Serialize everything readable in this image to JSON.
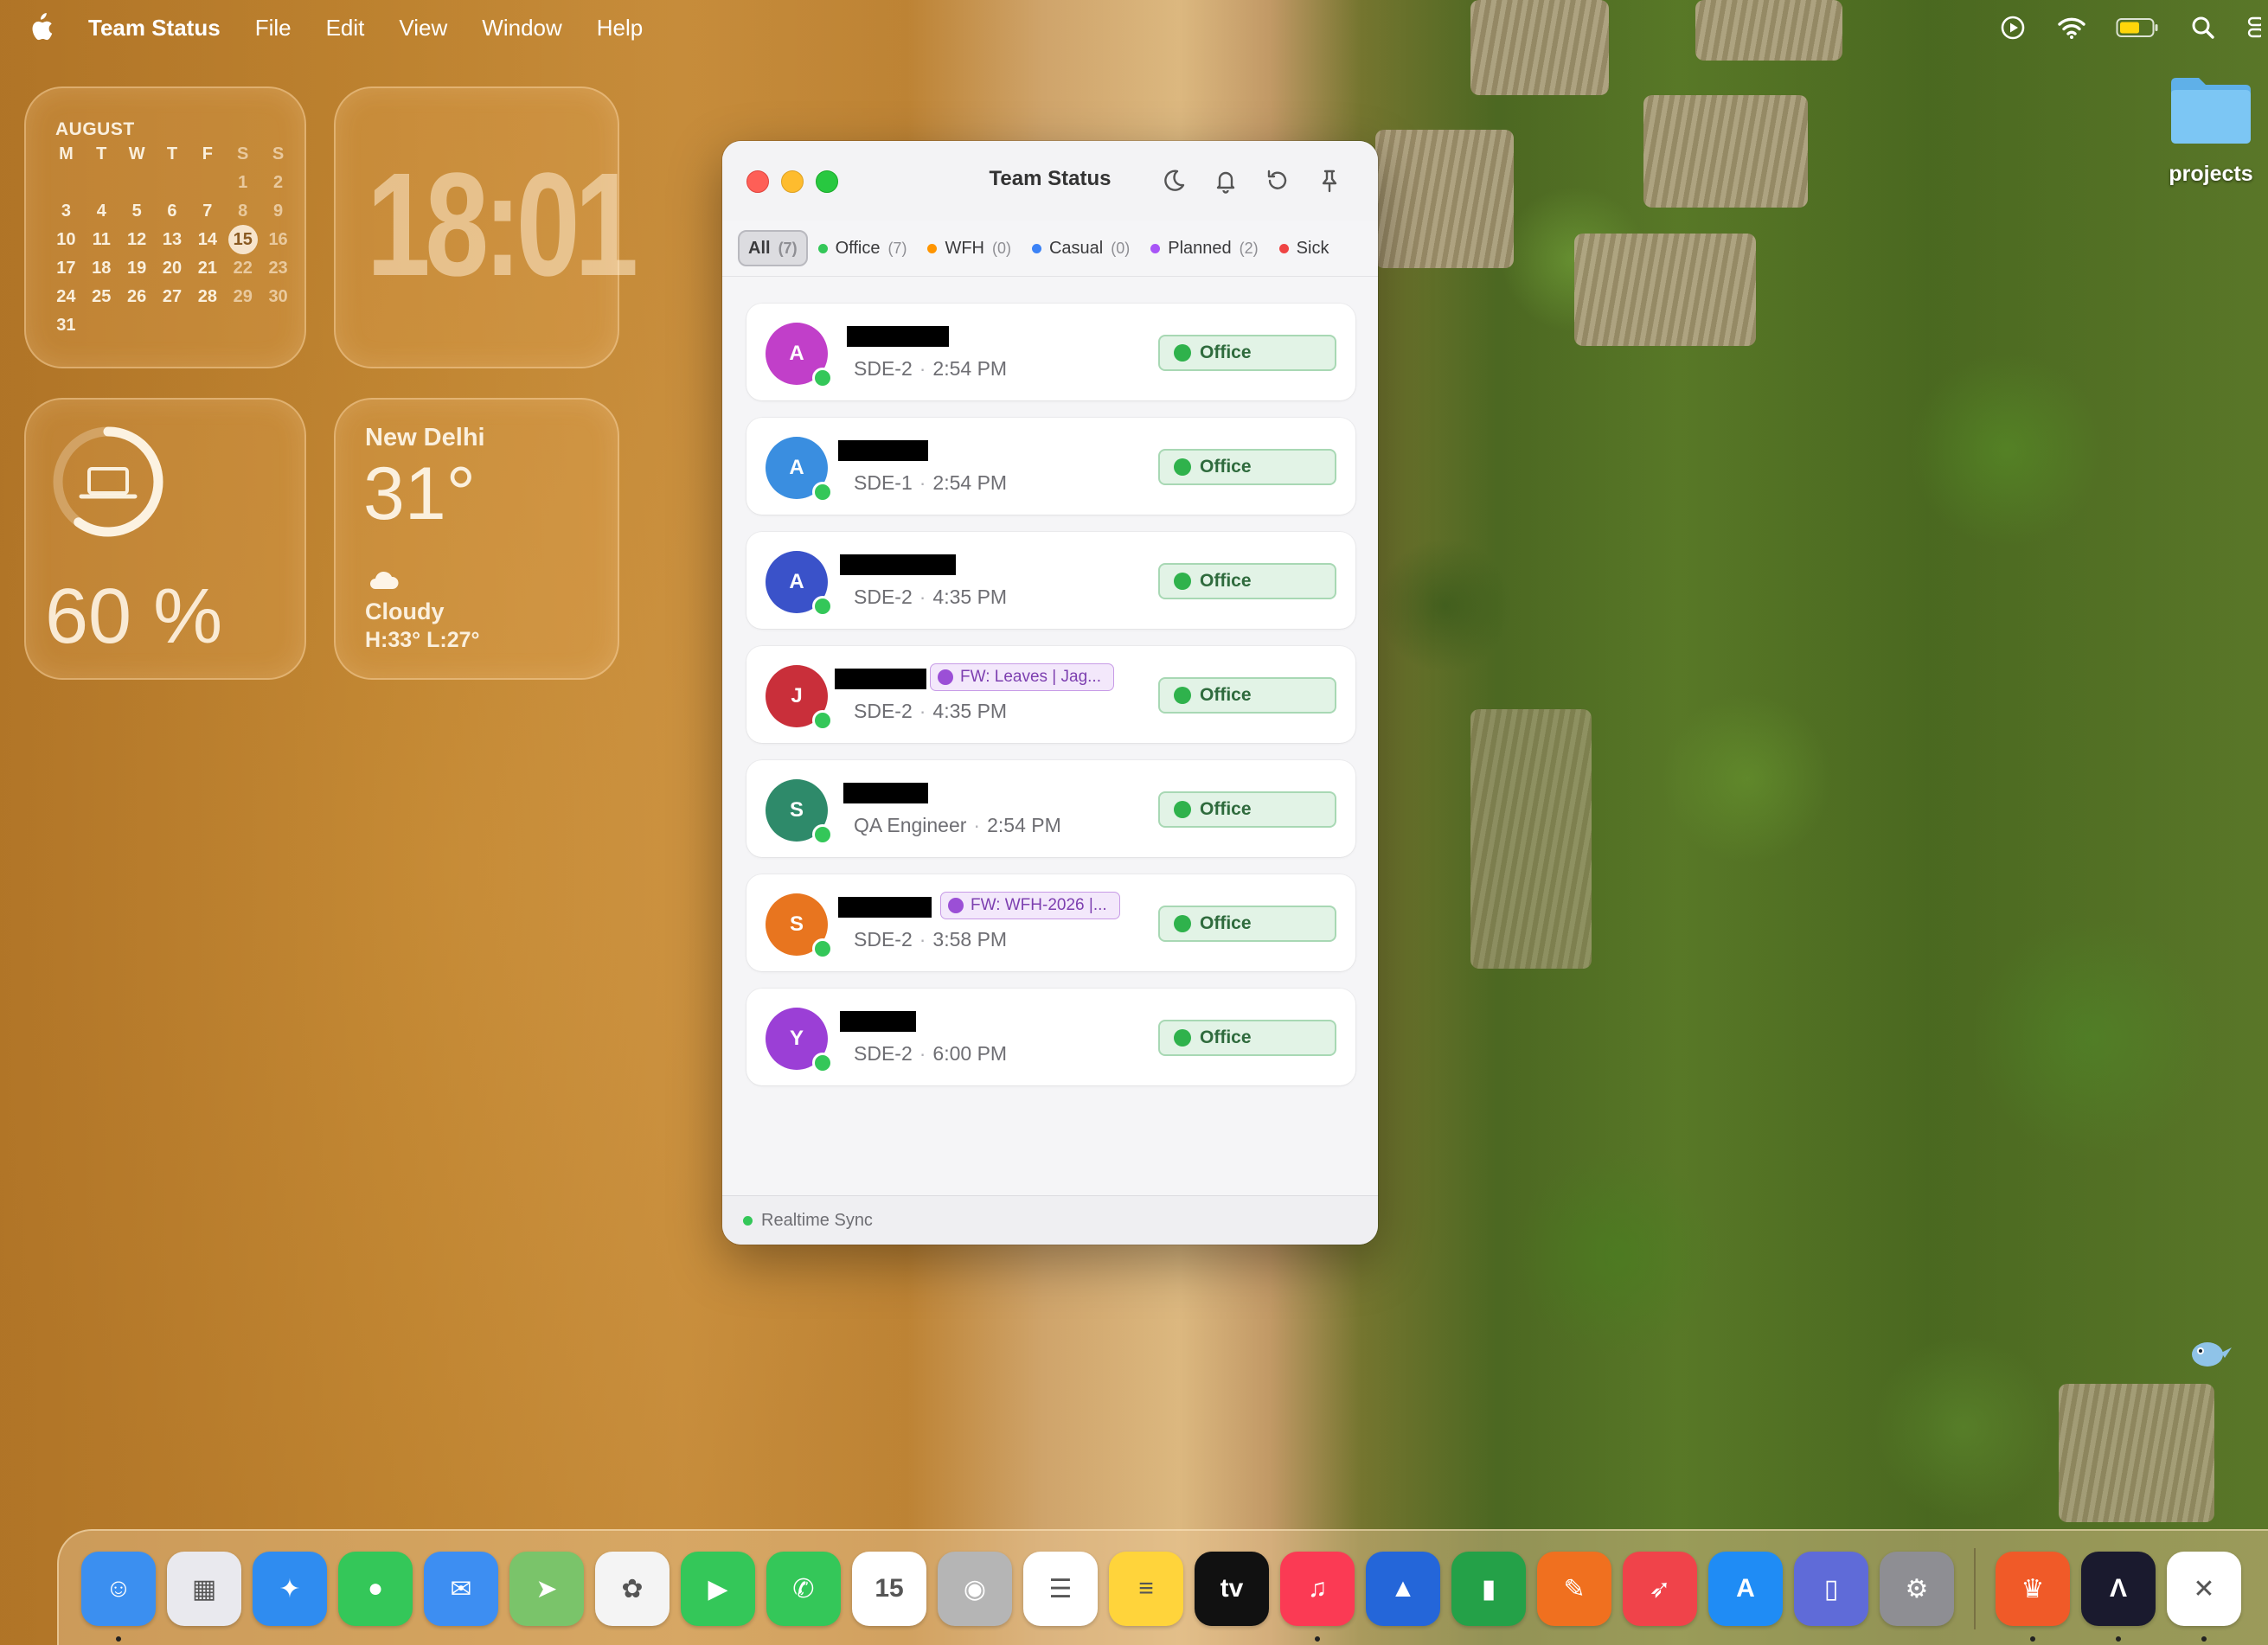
{
  "menubar": {
    "app_name": "Team Status",
    "menus": [
      "File",
      "Edit",
      "View",
      "Window",
      "Help"
    ],
    "status_icons": [
      "play-circle-icon",
      "wifi-icon",
      "battery-icon",
      "search-icon",
      "control-center-icon"
    ]
  },
  "widgets": {
    "calendar": {
      "month": "AUGUST",
      "weekdays": [
        "M",
        "T",
        "W",
        "T",
        "F",
        "S",
        "S"
      ],
      "today": "15",
      "weeks": [
        [
          "",
          "",
          "",
          "",
          "",
          "1",
          "2"
        ],
        [
          "3",
          "4",
          "5",
          "6",
          "7",
          "8",
          "9"
        ],
        [
          "10",
          "11",
          "12",
          "13",
          "14",
          "15",
          "16"
        ],
        [
          "17",
          "18",
          "19",
          "20",
          "21",
          "22",
          "23"
        ],
        [
          "24",
          "25",
          "26",
          "27",
          "28",
          "29",
          "30"
        ],
        [
          "31",
          "",
          "",
          "",
          "",
          "",
          ""
        ]
      ]
    },
    "clock": {
      "time": "18:01"
    },
    "battery": {
      "percent_label": "60 %",
      "level": 0.6,
      "icon": "laptop-icon"
    },
    "weather": {
      "city": "New Delhi",
      "temperature": "31°",
      "condition": "Cloudy",
      "range": "H:33° L:27°",
      "icon": "cloud-icon"
    }
  },
  "desktop": {
    "folder_label": "projects"
  },
  "window": {
    "title": "Team Status",
    "toolbar_icons": [
      "moon-icon",
      "bell-icon",
      "refresh-icon",
      "pin-icon"
    ],
    "filters": [
      {
        "label": "All",
        "count": "(7)",
        "color": ""
      },
      {
        "label": "Office",
        "count": "(7)",
        "color": "#34c759"
      },
      {
        "label": "WFH",
        "count": "(0)",
        "color": "#ff9500"
      },
      {
        "label": "Casual",
        "count": "(0)",
        "color": "#3b82f6"
      },
      {
        "label": "Planned",
        "count": "(2)",
        "color": "#a855f7"
      },
      {
        "label": "Sick",
        "count": "",
        "color": "#ef4444"
      }
    ],
    "members": [
      {
        "initial": "A",
        "color": "#c13fc9",
        "role": "SDE-2",
        "time": "2:54 PM",
        "status": "Office",
        "event": ""
      },
      {
        "initial": "A",
        "color": "#3a8ee0",
        "role": "SDE-1",
        "time": "2:54 PM",
        "status": "Office",
        "event": ""
      },
      {
        "initial": "A",
        "color": "#3a52c9",
        "role": "SDE-2",
        "time": "4:35 PM",
        "status": "Office",
        "event": ""
      },
      {
        "initial": "J",
        "color": "#c92f3a",
        "role": "SDE-2",
        "time": "4:35 PM",
        "status": "Office",
        "event": "FW: Leaves | Jag..."
      },
      {
        "initial": "S",
        "color": "#2e8a6a",
        "role": "QA Engineer",
        "time": "2:54 PM",
        "status": "Office",
        "event": ""
      },
      {
        "initial": "S",
        "color": "#e8751f",
        "role": "SDE-2",
        "time": "3:58 PM",
        "status": "Office",
        "event": "FW: WFH-2026 |..."
      },
      {
        "initial": "Y",
        "color": "#9b3fd6",
        "role": "SDE-2",
        "time": "6:00 PM",
        "status": "Office",
        "event": ""
      }
    ],
    "footer": "Realtime Sync"
  },
  "dock": {
    "apps": [
      {
        "name": "finder",
        "glyph": "☺",
        "bg": "#3b8ff0",
        "running": true
      },
      {
        "name": "launchpad",
        "glyph": "▦",
        "bg": "#e9e9ee",
        "running": false
      },
      {
        "name": "safari",
        "glyph": "✦",
        "bg": "#2f8cf0",
        "running": false
      },
      {
        "name": "messages",
        "glyph": "●",
        "bg": "#34c759",
        "running": false
      },
      {
        "name": "mail",
        "glyph": "✉",
        "bg": "#3d8ef2",
        "running": false
      },
      {
        "name": "maps",
        "glyph": "➤",
        "bg": "#7ac46a",
        "running": false
      },
      {
        "name": "photos",
        "glyph": "✿",
        "bg": "#f4f4f4",
        "running": false
      },
      {
        "name": "facetime",
        "glyph": "▶",
        "bg": "#34c759",
        "running": false
      },
      {
        "name": "phone",
        "glyph": "✆",
        "bg": "#34c759",
        "running": false
      },
      {
        "name": "calendar",
        "glyph": "15",
        "bg": "#ffffff",
        "running": false
      },
      {
        "name": "contacts",
        "glyph": "◉",
        "bg": "#b5b5b5",
        "running": false
      },
      {
        "name": "reminders",
        "glyph": "☰",
        "bg": "#ffffff",
        "running": false
      },
      {
        "name": "notes",
        "glyph": "≡",
        "bg": "#ffd43b",
        "running": false
      },
      {
        "name": "tv",
        "glyph": "tv",
        "bg": "#111111",
        "running": false
      },
      {
        "name": "music",
        "glyph": "♫",
        "bg": "#fb3a54",
        "running": true
      },
      {
        "name": "keynote",
        "glyph": "▲",
        "bg": "#2466d9",
        "running": false
      },
      {
        "name": "numbers",
        "glyph": "▮",
        "bg": "#24a148",
        "running": false
      },
      {
        "name": "pages",
        "glyph": "✎",
        "bg": "#f0701f",
        "running": false
      },
      {
        "name": "rocket",
        "glyph": "➶",
        "bg": "#f0434a",
        "running": false
      },
      {
        "name": "app-store",
        "glyph": "A",
        "bg": "#1f8cf5",
        "running": false
      },
      {
        "name": "iphone-mirroring",
        "glyph": "▯",
        "bg": "#5f6bd8",
        "running": false
      },
      {
        "name": "system-settings",
        "glyph": "⚙",
        "bg": "#8e8e93",
        "running": false
      },
      {
        "name": "brave",
        "glyph": "♛",
        "bg": "#f05a28",
        "running": true
      },
      {
        "name": "arc",
        "glyph": "Λ",
        "bg": "#1a1a2e",
        "running": true
      },
      {
        "name": "jira",
        "glyph": "✕",
        "bg": "#ffffff",
        "running": true
      }
    ]
  }
}
